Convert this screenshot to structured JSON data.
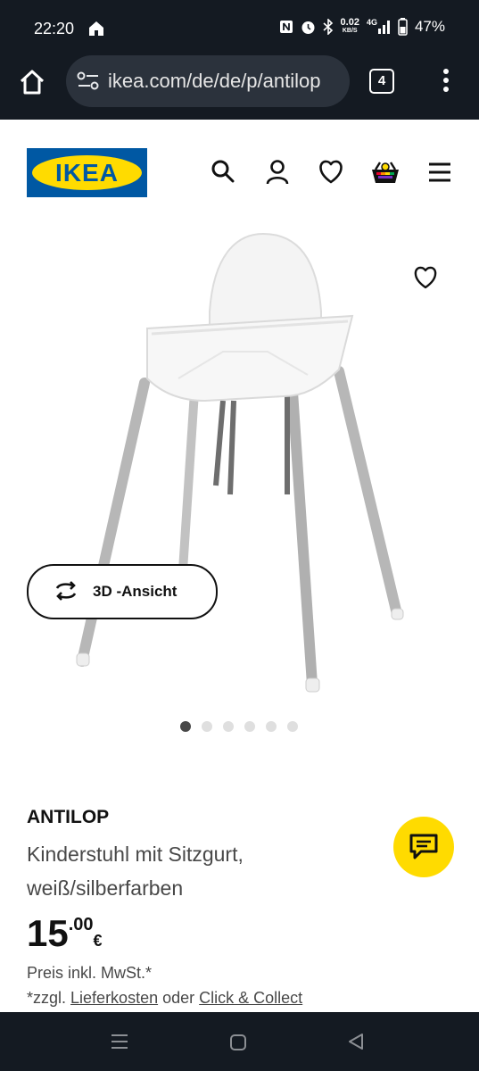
{
  "status_bar": {
    "time": "22:20",
    "speed_value": "0.02",
    "speed_unit": "KB/S",
    "network": "4G",
    "battery": "47%"
  },
  "browser": {
    "url": "ikea.com/de/de/p/antilop",
    "tab_count": "4"
  },
  "header": {
    "logo_text": "IKEA",
    "brand_blue": "#0058a3",
    "brand_yellow": "#ffdb00"
  },
  "gallery": {
    "view_3d_label": "3D -Ansicht",
    "image_count": 6,
    "active_index": 0
  },
  "product": {
    "name": "ANTILOP",
    "description": "Kinderstuhl mit Sitzgurt, weiß/silberfarben",
    "price_integer": "15",
    "price_decimal": ".00",
    "currency": "€",
    "vat_note": "Preis inkl. MwSt.*",
    "shipping_prefix": "*zzgl.",
    "shipping_link": "Lieferkosten",
    "shipping_or": "oder",
    "click_collect_link": "Click & Collect"
  }
}
